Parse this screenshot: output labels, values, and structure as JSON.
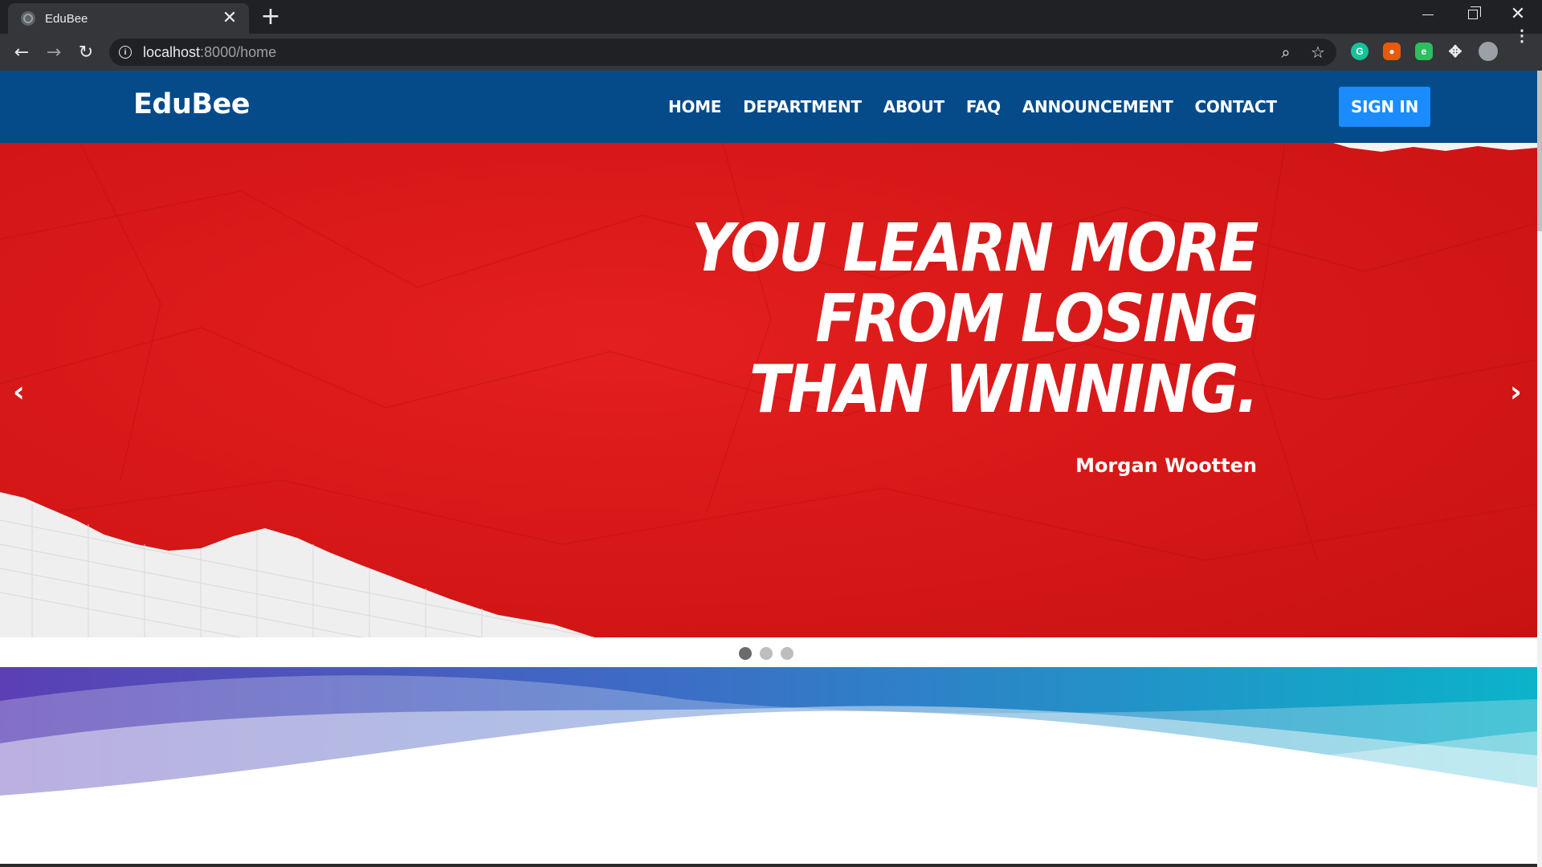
{
  "browser": {
    "tab_title": "EduBee",
    "tab_close": "✕",
    "new_tab": "+",
    "url_host": "localhost",
    "url_path": ":8000/home",
    "icons": [
      "globe-icon",
      "back-icon",
      "forward-icon",
      "reload-icon",
      "info-icon",
      "zoom-icon",
      "star-icon",
      "grammarly-icon",
      "fox-icon",
      "evernote-icon",
      "puzzle-icon",
      "avatar-icon",
      "kebab-menu-icon"
    ]
  },
  "site": {
    "brand": "EduBee",
    "nav": [
      "HOME",
      "DEPARTMENT",
      "ABOUT",
      "FAQ",
      "ANNOUNCEMENT",
      "CONTACT"
    ],
    "signin": "SIGN IN",
    "colors": {
      "navbar": "#054b8a",
      "signin": "#1a8cff",
      "hero": "#d81818"
    }
  },
  "carousel": {
    "quote_lines": [
      "YOU LEARN MORE",
      "FROM LOSING",
      "THAN WINNING."
    ],
    "author": "Morgan Wootten",
    "prev": "‹",
    "next": "›",
    "slide_count": 3,
    "active_index": 0
  }
}
